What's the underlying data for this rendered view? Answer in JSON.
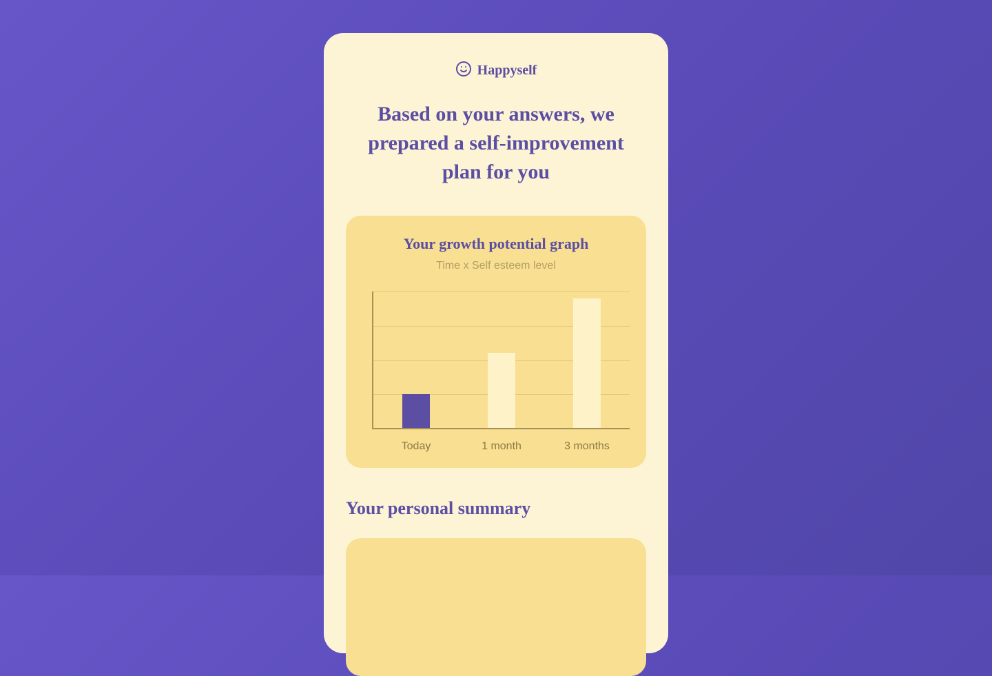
{
  "brand": {
    "name": "Happyself"
  },
  "headline": "Based on your answers, we prepared a self-improvement plan for you",
  "chart": {
    "title": "Your growth potential graph",
    "subtitle": "Time x Self esteem level"
  },
  "chart_data": {
    "type": "bar",
    "categories": [
      "Today",
      "1 month",
      "3 months"
    ],
    "values": [
      25,
      55,
      95
    ],
    "title": "Your growth potential graph",
    "xlabel": "Time",
    "ylabel": "Self esteem level",
    "ylim": [
      0,
      100
    ],
    "gridlines": 5
  },
  "summary": {
    "heading": "Your personal summary"
  },
  "colors": {
    "accent_purple": "#5b4ea3",
    "card_bg": "#fdf4d6",
    "chart_bg": "#f8df91",
    "bar_light": "#fdf2c8"
  }
}
